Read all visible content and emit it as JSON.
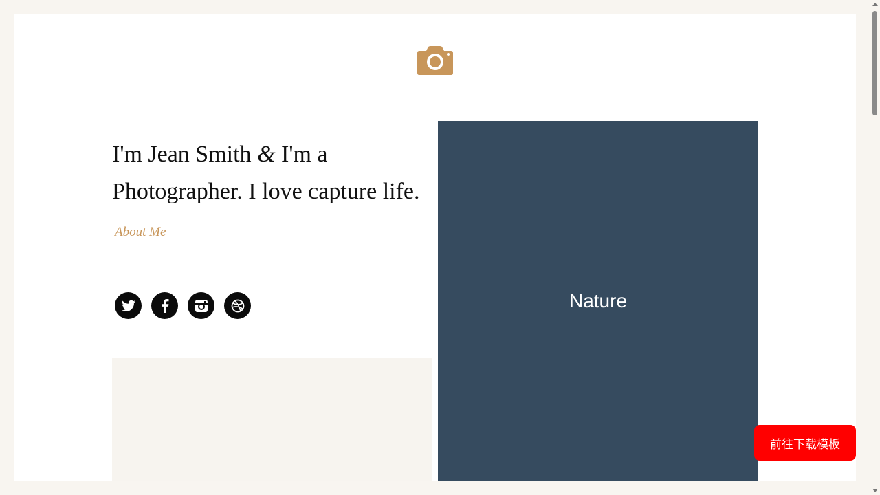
{
  "brand": {
    "icon": "camera-icon",
    "color": "#c8965a"
  },
  "intro": {
    "part1": "I'm Jean Smith ",
    "amp": "&",
    "part2": " I'm a Photographer. I love capture life.",
    "about_link": "About Me"
  },
  "social": [
    {
      "icon": "twitter-icon"
    },
    {
      "icon": "facebook-icon"
    },
    {
      "icon": "instagram-icon"
    },
    {
      "icon": "dribbble-icon"
    }
  ],
  "gallery": {
    "tile_label": "Nature",
    "tile_color": "#364b5f"
  },
  "download_button": {
    "label": "前往下载模板",
    "color": "#ff0000"
  }
}
